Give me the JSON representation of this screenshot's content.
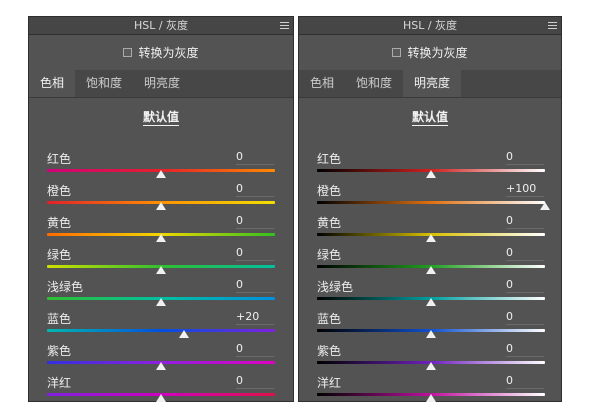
{
  "panels": [
    {
      "title": "HSL / 灰度",
      "gray_label": "转换为灰度",
      "tabs": [
        {
          "label": "色相",
          "active": true
        },
        {
          "label": "饱和度",
          "active": false
        },
        {
          "label": "明亮度",
          "active": false
        }
      ],
      "defaults_label": "默认值",
      "sliders": [
        {
          "label": "红色",
          "value": "0",
          "pos": 0.5,
          "gradient": "linear-gradient(to right,#d0007a,#e5202a,#ff8a00)"
        },
        {
          "label": "橙色",
          "value": "0",
          "pos": 0.5,
          "gradient": "linear-gradient(to right,#e0202a,#ff9000,#f0e000)"
        },
        {
          "label": "黄色",
          "value": "0",
          "pos": 0.5,
          "gradient": "linear-gradient(to right,#ff6a00,#f0d800,#30c020)"
        },
        {
          "label": "绿色",
          "value": "0",
          "pos": 0.5,
          "gradient": "linear-gradient(to right,#d0e000,#30c030,#00c0a0)"
        },
        {
          "label": "浅绿色",
          "value": "0",
          "pos": 0.5,
          "gradient": "linear-gradient(to right,#30c030,#00c0a0,#0090e0)"
        },
        {
          "label": "蓝色",
          "value": "+20",
          "pos": 0.6,
          "gradient": "linear-gradient(to right,#00b8b0,#0050e0,#8020e0)"
        },
        {
          "label": "紫色",
          "value": "0",
          "pos": 0.5,
          "gradient": "linear-gradient(to right,#3030e0,#9020e0,#e000c0)"
        },
        {
          "label": "洋红",
          "value": "0",
          "pos": 0.5,
          "gradient": "linear-gradient(to right,#8020e0,#d000c0,#e0104a)"
        }
      ]
    },
    {
      "title": "HSL / 灰度",
      "gray_label": "转换为灰度",
      "tabs": [
        {
          "label": "色相",
          "active": false
        },
        {
          "label": "饱和度",
          "active": false
        },
        {
          "label": "明亮度",
          "active": true
        }
      ],
      "defaults_label": "默认值",
      "sliders": [
        {
          "label": "红色",
          "value": "0",
          "pos": 0.5,
          "gradient": "linear-gradient(to right,#000000,#d02020,#ffffff)"
        },
        {
          "label": "橙色",
          "value": "+100",
          "pos": 1.0,
          "gradient": "linear-gradient(to right,#000000,#e07010,#ffffff)"
        },
        {
          "label": "黄色",
          "value": "0",
          "pos": 0.5,
          "gradient": "linear-gradient(to right,#000000,#d8c000,#ffffff)"
        },
        {
          "label": "绿色",
          "value": "0",
          "pos": 0.5,
          "gradient": "linear-gradient(to right,#000000,#20a020,#ffffff)"
        },
        {
          "label": "浅绿色",
          "value": "0",
          "pos": 0.5,
          "gradient": "linear-gradient(to right,#000000,#00a0a0,#ffffff)"
        },
        {
          "label": "蓝色",
          "value": "0",
          "pos": 0.5,
          "gradient": "linear-gradient(to right,#000000,#1050d0,#ffffff)"
        },
        {
          "label": "紫色",
          "value": "0",
          "pos": 0.5,
          "gradient": "linear-gradient(to right,#000000,#7020c0,#ffffff)"
        },
        {
          "label": "洋红",
          "value": "0",
          "pos": 0.5,
          "gradient": "linear-gradient(to right,#000000,#c010a0,#ffffff)"
        }
      ]
    }
  ]
}
